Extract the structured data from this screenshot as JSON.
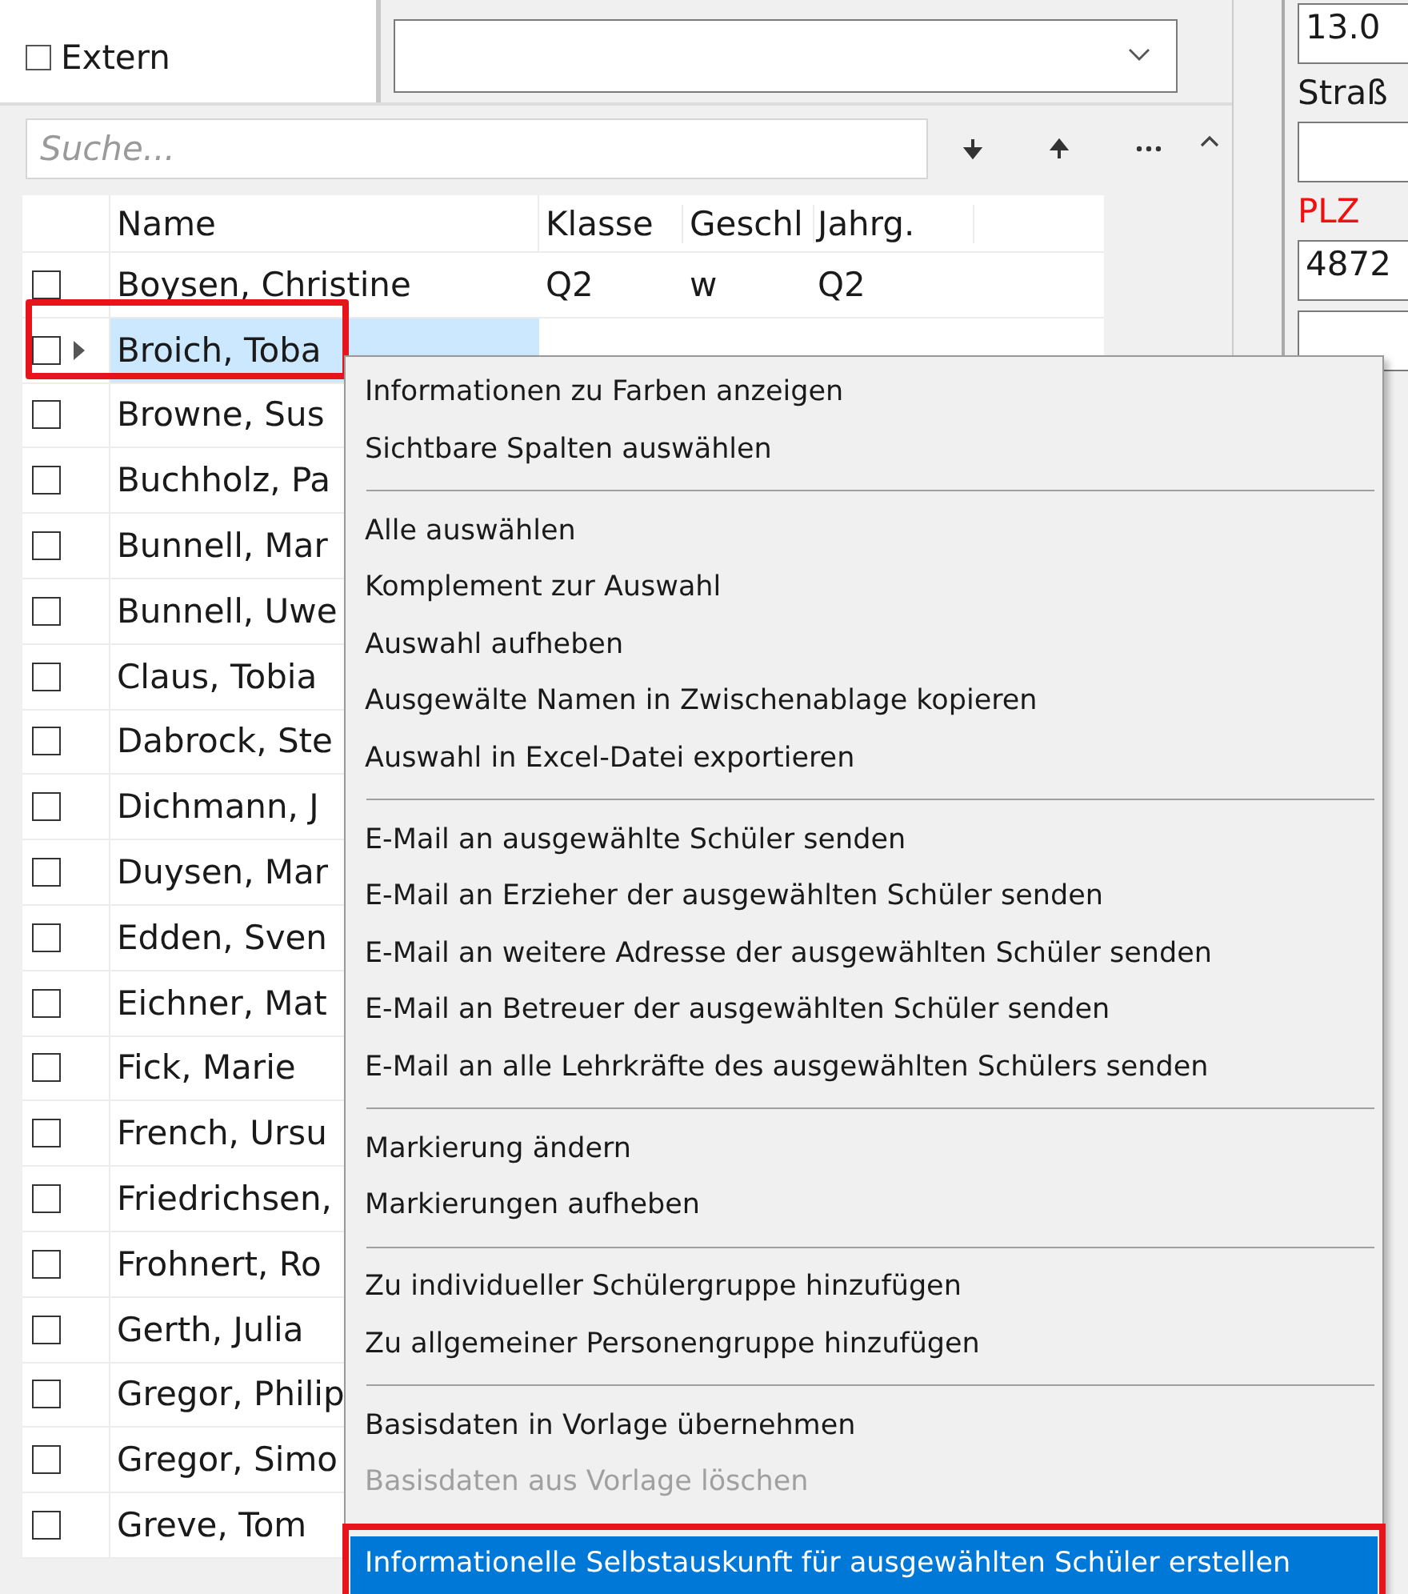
{
  "top_panel": {
    "extern": {
      "label": "Extern",
      "checked": false
    }
  },
  "right_panel": [
    {
      "kind": "field",
      "value": "13.0"
    },
    {
      "kind": "label",
      "text": "Straß",
      "required": false
    },
    {
      "kind": "field"
    },
    {
      "kind": "label",
      "text": "PLZ",
      "required": true
    },
    {
      "kind": "field",
      "value": "4872"
    },
    {
      "kind": "field"
    }
  ],
  "search": {
    "placeholder": "Suche..."
  },
  "table": {
    "columns": [
      "Name",
      "Klasse",
      "Geschl",
      "Jahrg."
    ],
    "rows": [
      {
        "name": "Boysen, Christine",
        "klasse": "Q2",
        "geschl": "w",
        "jahrg": "Q2",
        "checked": false,
        "selected": false,
        "marked": false
      },
      {
        "name": "Broich, Toba",
        "checked": false,
        "selected": true,
        "marked": true
      },
      {
        "name": "Browne, Sus",
        "checked": false,
        "selected": false,
        "marked": false
      },
      {
        "name": "Buchholz, Pa",
        "checked": false,
        "selected": false,
        "marked": false
      },
      {
        "name": "Bunnell, Mar",
        "checked": false,
        "selected": false,
        "marked": false
      },
      {
        "name": "Bunnell, Uwe",
        "checked": false,
        "selected": false,
        "marked": false
      },
      {
        "name": "Claus, Tobia",
        "checked": false,
        "selected": false,
        "marked": false
      },
      {
        "name": "Dabrock, Ste",
        "checked": false,
        "selected": false,
        "marked": false
      },
      {
        "name": "Dichmann, J",
        "checked": false,
        "selected": false,
        "marked": false
      },
      {
        "name": "Duysen, Mar",
        "checked": false,
        "selected": false,
        "marked": false
      },
      {
        "name": "Edden, Sven",
        "checked": false,
        "selected": false,
        "marked": false
      },
      {
        "name": "Eichner, Mat",
        "checked": false,
        "selected": false,
        "marked": false
      },
      {
        "name": "Fick, Marie",
        "checked": false,
        "selected": false,
        "marked": false
      },
      {
        "name": "French, Ursu",
        "checked": false,
        "selected": false,
        "marked": false
      },
      {
        "name": "Friedrichsen,",
        "checked": false,
        "selected": false,
        "marked": false
      },
      {
        "name": "Frohnert, Ro",
        "checked": false,
        "selected": false,
        "marked": false
      },
      {
        "name": "Gerth, Julia",
        "checked": false,
        "selected": false,
        "marked": false
      },
      {
        "name": "Gregor, Philip",
        "checked": false,
        "selected": false,
        "marked": false
      },
      {
        "name": "Gregor, Simo",
        "checked": false,
        "selected": false,
        "marked": false
      },
      {
        "name": "Greve, Tom",
        "checked": false,
        "selected": false,
        "marked": false
      }
    ]
  },
  "context_menu": [
    [
      {
        "label": "Informationen zu Farben anzeigen",
        "disabled": false,
        "selected": false,
        "marked": false
      },
      {
        "label": "Sichtbare Spalten auswählen",
        "disabled": false,
        "selected": false,
        "marked": false
      }
    ],
    [
      {
        "label": "Alle auswählen",
        "disabled": false,
        "selected": false,
        "marked": false
      },
      {
        "label": "Komplement zur Auswahl",
        "disabled": false,
        "selected": false,
        "marked": false
      },
      {
        "label": "Auswahl aufheben",
        "disabled": false,
        "selected": false,
        "marked": false
      },
      {
        "label": "Ausgewälte Namen in Zwischenablage kopieren",
        "disabled": false,
        "selected": false,
        "marked": false
      },
      {
        "label": "Auswahl in Excel-Datei exportieren",
        "disabled": false,
        "selected": false,
        "marked": false
      }
    ],
    [
      {
        "label": "E-Mail an ausgewählte Schüler senden",
        "disabled": false,
        "selected": false,
        "marked": false
      },
      {
        "label": "E-Mail an Erzieher der ausgewählten Schüler senden",
        "disabled": false,
        "selected": false,
        "marked": false
      },
      {
        "label": "E-Mail an weitere Adresse der ausgewählten Schüler senden",
        "disabled": false,
        "selected": false,
        "marked": false
      },
      {
        "label": "E-Mail an Betreuer der ausgewählten Schüler senden",
        "disabled": false,
        "selected": false,
        "marked": false
      },
      {
        "label": "E-Mail an alle Lehrkräfte des ausgewählten Schülers senden",
        "disabled": false,
        "selected": false,
        "marked": false
      }
    ],
    [
      {
        "label": "Markierung ändern",
        "disabled": false,
        "selected": false,
        "marked": false
      },
      {
        "label": "Markierungen aufheben",
        "disabled": false,
        "selected": false,
        "marked": false
      }
    ],
    [
      {
        "label": "Zu individueller Schülergruppe hinzufügen",
        "disabled": false,
        "selected": false,
        "marked": false
      },
      {
        "label": "Zu allgemeiner Personengruppe hinzufügen",
        "disabled": false,
        "selected": false,
        "marked": false
      }
    ],
    [
      {
        "label": "Basisdaten in Vorlage übernehmen",
        "disabled": false,
        "selected": false,
        "marked": false
      },
      {
        "label": "Basisdaten aus Vorlage löschen",
        "disabled": true,
        "selected": false,
        "marked": false
      }
    ],
    [
      {
        "label": "Informationelle Selbstauskunft für ausgewählten Schüler erstellen",
        "disabled": false,
        "selected": true,
        "marked": true
      }
    ]
  ]
}
